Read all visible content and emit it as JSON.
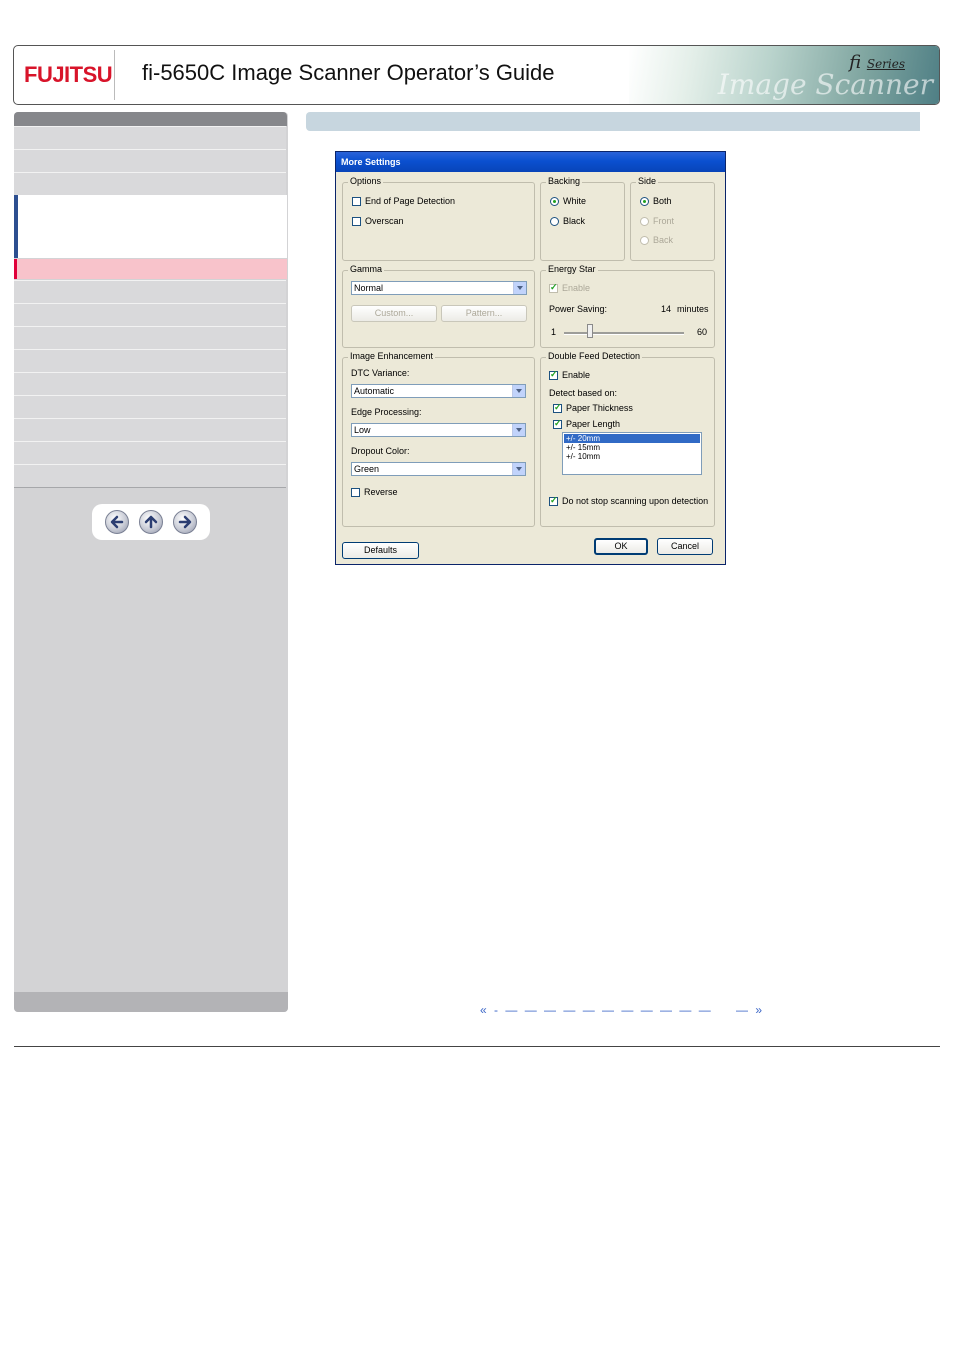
{
  "header": {
    "logo_text": "FUJITSU",
    "title": "fi-5650C Image Scanner Operator’s Guide",
    "series_badge": "fi",
    "series_word": "Series",
    "art_word": "Image Scanner"
  },
  "dialog": {
    "title": "More Settings",
    "options": {
      "label": "Options",
      "end_of_page": "End of Page Detection",
      "overscan": "Overscan"
    },
    "backing": {
      "label": "Backing",
      "white": "White",
      "black": "Black"
    },
    "side": {
      "label": "Side",
      "both": "Both",
      "front": "Front",
      "back": "Back"
    },
    "gamma": {
      "label": "Gamma",
      "value": "Normal",
      "custom": "Custom...",
      "pattern": "Pattern..."
    },
    "energy_star": {
      "label": "Energy Star",
      "enable": "Enable",
      "power_saving": "Power Saving:",
      "minutes_value": "14",
      "minutes_unit": "minutes",
      "min": "1",
      "max": "60",
      "slider_level": 14
    },
    "image_enhancement": {
      "label": "Image Enhancement",
      "dtc_label": "DTC Variance:",
      "dtc_value": "Automatic",
      "edge_label": "Edge Processing:",
      "edge_value": "Low",
      "dropout_label": "Dropout Color:",
      "dropout_value": "Green",
      "reverse": "Reverse"
    },
    "double_feed": {
      "label": "Double Feed Detection",
      "enable": "Enable",
      "detect_based_on": "Detect based on:",
      "paper_thickness": "Paper Thickness",
      "paper_length": "Paper Length",
      "lengths": [
        "+/- 20mm",
        "+/- 15mm",
        "+/- 10mm"
      ],
      "do_not_stop": "Do not stop scanning upon detection"
    },
    "buttons": {
      "defaults": "Defaults",
      "ok": "OK",
      "cancel": "Cancel"
    }
  },
  "pager": {
    "prev": "«",
    "dashes": "- — — — — — — — — — — —",
    "dash_end": "—",
    "next": "»"
  }
}
